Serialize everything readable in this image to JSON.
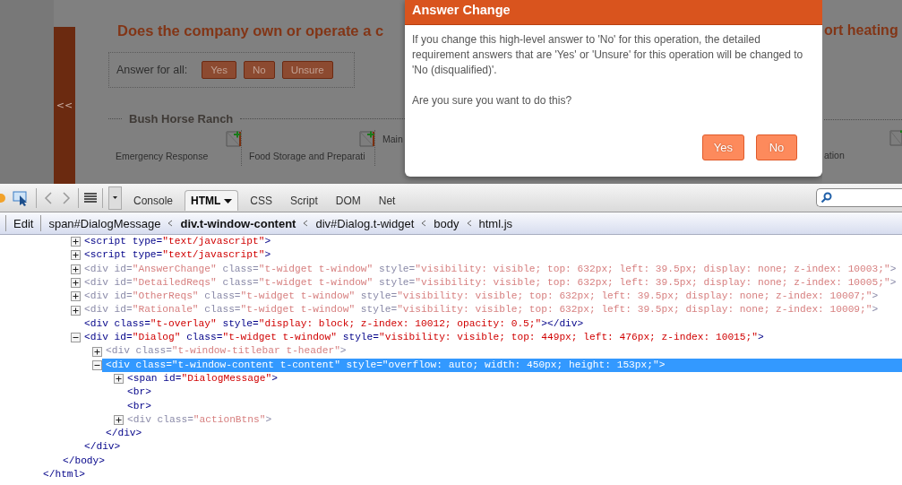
{
  "page": {
    "collapse_button": "<<",
    "heading_left": "Does the company own or operate a c",
    "heading_right": "ort heating",
    "answer_label": "Answer for all:",
    "answer_buttons": [
      "Yes",
      "No",
      "Unsure"
    ],
    "section_title": "Bush Horse Ranch",
    "columns_left": [
      {
        "label": "Emergency Response",
        "note": true
      },
      {
        "label": "Food Storage and Preparati",
        "note": true
      },
      {
        "label": "Main",
        "note": false
      }
    ],
    "columns_right": [
      {
        "label": "ation",
        "note": true
      }
    ]
  },
  "dialog": {
    "title": "Answer Change",
    "message": "If you change this high-level answer to 'No' for this operation, the detailed requirement answers that are 'Yes' or 'Unsure' for this operation will be changed to 'No (disqualified)'.",
    "question": "Are you sure you want to do this?",
    "buttons": [
      "Yes",
      "No"
    ]
  },
  "devtools": {
    "tabs": [
      {
        "label": "Console",
        "selected": false
      },
      {
        "label": "HTML",
        "selected": true
      },
      {
        "label": "CSS",
        "selected": false
      },
      {
        "label": "Script",
        "selected": false
      },
      {
        "label": "DOM",
        "selected": false
      },
      {
        "label": "Net",
        "selected": false
      }
    ],
    "breadcrumb": {
      "edit": "Edit",
      "items": [
        {
          "label": "span#DialogMessage",
          "selected": false
        },
        {
          "label": "div.t-window-content",
          "selected": true
        },
        {
          "label": "div#Dialog.t-widget",
          "selected": false
        },
        {
          "label": "body",
          "selected": false
        },
        {
          "label": "html.js",
          "selected": false
        }
      ]
    },
    "html_tree": {
      "close": "</html>",
      "children": [
        {
          "close": "</body>",
          "children": [
            {
              "expanded": false,
              "dimmed": false,
              "selected": false,
              "parts": [
                {
                  "kind": "tag",
                  "text": "<script"
                },
                {
                  "kind": "attr",
                  "text": " type="
                },
                {
                  "kind": "value",
                  "text": "\"text/javascript\""
                },
                {
                  "kind": "tag",
                  "text": ">"
                }
              ]
            },
            {
              "expanded": false,
              "dimmed": false,
              "selected": false,
              "parts": [
                {
                  "kind": "tag",
                  "text": "<script"
                },
                {
                  "kind": "attr",
                  "text": " type="
                },
                {
                  "kind": "value",
                  "text": "\"text/javascript\""
                },
                {
                  "kind": "tag",
                  "text": ">"
                }
              ]
            },
            {
              "expanded": false,
              "dimmed": true,
              "selected": false,
              "parts": [
                {
                  "kind": "tag",
                  "text": "<div"
                },
                {
                  "kind": "attr",
                  "text": " id="
                },
                {
                  "kind": "value",
                  "text": "\"AnswerChange\""
                },
                {
                  "kind": "attr",
                  "text": " class="
                },
                {
                  "kind": "value",
                  "text": "\"t-widget t-window\""
                },
                {
                  "kind": "attr",
                  "text": " style="
                },
                {
                  "kind": "value",
                  "text": "\"visibility: visible; top: 632px; left: 39.5px; display: none; z-index: 10003;\""
                },
                {
                  "kind": "tag",
                  "text": ">"
                }
              ]
            },
            {
              "expanded": false,
              "dimmed": true,
              "selected": false,
              "parts": [
                {
                  "kind": "tag",
                  "text": "<div"
                },
                {
                  "kind": "attr",
                  "text": " id="
                },
                {
                  "kind": "value",
                  "text": "\"DetailedReqs\""
                },
                {
                  "kind": "attr",
                  "text": " class="
                },
                {
                  "kind": "value",
                  "text": "\"t-widget t-window\""
                },
                {
                  "kind": "attr",
                  "text": " style="
                },
                {
                  "kind": "value",
                  "text": "\"visibility: visible; top: 632px; left: 39.5px; display: none; z-index: 10005;\""
                },
                {
                  "kind": "tag",
                  "text": ">"
                }
              ]
            },
            {
              "expanded": false,
              "dimmed": true,
              "selected": false,
              "parts": [
                {
                  "kind": "tag",
                  "text": "<div"
                },
                {
                  "kind": "attr",
                  "text": " id="
                },
                {
                  "kind": "value",
                  "text": "\"OtherReqs\""
                },
                {
                  "kind": "attr",
                  "text": " class="
                },
                {
                  "kind": "value",
                  "text": "\"t-widget t-window\""
                },
                {
                  "kind": "attr",
                  "text": " style="
                },
                {
                  "kind": "value",
                  "text": "\"visibility: visible; top: 632px; left: 39.5px; display: none; z-index: 10007;\""
                },
                {
                  "kind": "tag",
                  "text": ">"
                }
              ]
            },
            {
              "expanded": false,
              "dimmed": true,
              "selected": false,
              "parts": [
                {
                  "kind": "tag",
                  "text": "<div"
                },
                {
                  "kind": "attr",
                  "text": " id="
                },
                {
                  "kind": "value",
                  "text": "\"Rationale\""
                },
                {
                  "kind": "attr",
                  "text": " class="
                },
                {
                  "kind": "value",
                  "text": "\"t-widget t-window\""
                },
                {
                  "kind": "attr",
                  "text": " style="
                },
                {
                  "kind": "value",
                  "text": "\"visibility: visible; top: 632px; left: 39.5px; display: none; z-index: 10009;\""
                },
                {
                  "kind": "tag",
                  "text": ">"
                }
              ]
            },
            {
              "dimmed": false,
              "selected": false,
              "parts": [
                {
                  "kind": "tag",
                  "text": "<div"
                },
                {
                  "kind": "attr",
                  "text": " class="
                },
                {
                  "kind": "value",
                  "text": "\"t-overlay\""
                },
                {
                  "kind": "attr",
                  "text": " style="
                },
                {
                  "kind": "value",
                  "text": "\"display: block; z-index: 10012; opacity: 0.5;\""
                },
                {
                  "kind": "tag",
                  "text": "></div>"
                }
              ]
            },
            {
              "expanded": true,
              "dimmed": false,
              "selected": false,
              "parts": [
                {
                  "kind": "tag",
                  "text": "<div"
                },
                {
                  "kind": "attr",
                  "text": " id="
                },
                {
                  "kind": "value",
                  "text": "\"Dialog\""
                },
                {
                  "kind": "attr",
                  "text": " class="
                },
                {
                  "kind": "value",
                  "text": "\"t-widget t-window\""
                },
                {
                  "kind": "attr",
                  "text": " style="
                },
                {
                  "kind": "value",
                  "text": "\"visibility: visible; top: 449px; left: 476px; z-index: 10015;\""
                },
                {
                  "kind": "tag",
                  "text": ">"
                }
              ],
              "close": "</div>",
              "children": [
                {
                  "expanded": false,
                  "dimmed": true,
                  "selected": false,
                  "parts": [
                    {
                      "kind": "tag",
                      "text": "<div"
                    },
                    {
                      "kind": "attr",
                      "text": " class="
                    },
                    {
                      "kind": "value",
                      "text": "\"t-window-titlebar t-header\""
                    },
                    {
                      "kind": "tag",
                      "text": ">"
                    }
                  ]
                },
                {
                  "expanded": true,
                  "dimmed": false,
                  "selected": true,
                  "parts": [
                    {
                      "kind": "tag",
                      "text": "<div"
                    },
                    {
                      "kind": "attr",
                      "text": " class="
                    },
                    {
                      "kind": "value",
                      "text": "\"t-window-content t-content\""
                    },
                    {
                      "kind": "attr",
                      "text": " style="
                    },
                    {
                      "kind": "value",
                      "text": "\"overflow: auto; width: 450px; height: 153px;\""
                    },
                    {
                      "kind": "tag",
                      "text": ">"
                    }
                  ],
                  "close": "</div>",
                  "children": [
                    {
                      "expanded": false,
                      "dimmed": false,
                      "selected": false,
                      "parts": [
                        {
                          "kind": "tag",
                          "text": "<span"
                        },
                        {
                          "kind": "attr",
                          "text": " id="
                        },
                        {
                          "kind": "value",
                          "text": "\"DialogMessage\""
                        },
                        {
                          "kind": "tag",
                          "text": ">"
                        }
                      ]
                    },
                    {
                      "dimmed": false,
                      "selected": false,
                      "parts": [
                        {
                          "kind": "tag",
                          "text": "<br>"
                        }
                      ]
                    },
                    {
                      "dimmed": false,
                      "selected": false,
                      "parts": [
                        {
                          "kind": "tag",
                          "text": "<br>"
                        }
                      ]
                    },
                    {
                      "expanded": false,
                      "dimmed": true,
                      "selected": false,
                      "parts": [
                        {
                          "kind": "tag",
                          "text": "<div"
                        },
                        {
                          "kind": "attr",
                          "text": " class="
                        },
                        {
                          "kind": "value",
                          "text": "\"actionBtns\""
                        },
                        {
                          "kind": "tag",
                          "text": ">"
                        }
                      ]
                    }
                  ]
                }
              ]
            }
          ]
        }
      ]
    }
  }
}
